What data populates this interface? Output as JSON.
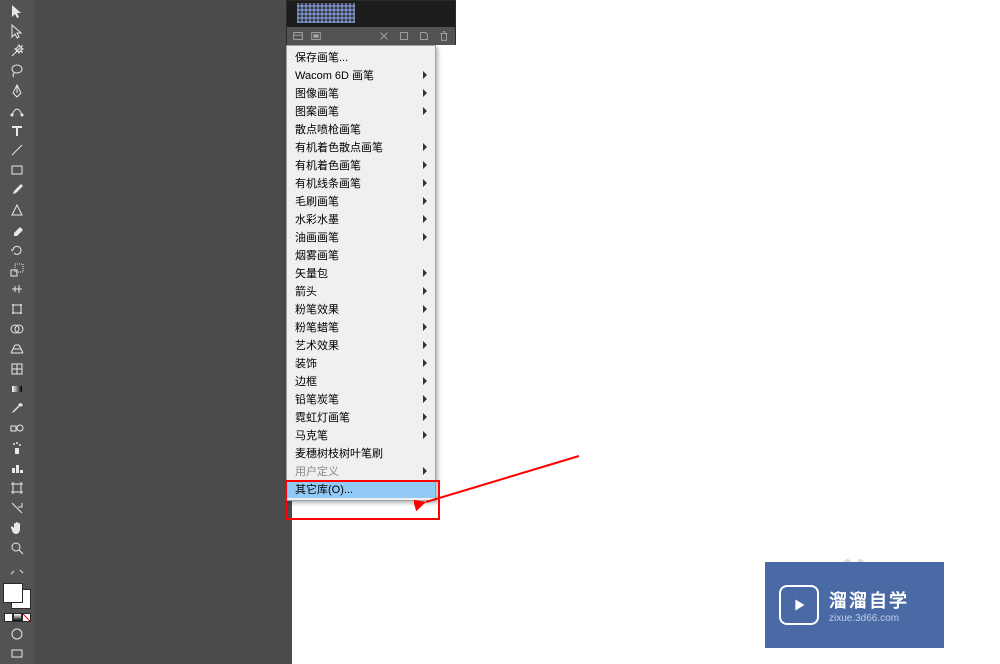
{
  "toolbar": {
    "tools": [
      "selection-tool",
      "direct-selection-tool",
      "magic-wand-tool",
      "lasso-tool",
      "pen-tool",
      "curvature-tool",
      "type-tool",
      "line-segment-tool",
      "rectangle-tool",
      "paintbrush-tool",
      "shaper-tool",
      "eraser-tool",
      "rotate-tool",
      "scale-tool",
      "width-tool",
      "free-transform-tool",
      "shape-builder-tool",
      "perspective-grid-tool",
      "mesh-tool",
      "gradient-tool",
      "eyedropper-tool",
      "blend-tool",
      "symbol-sprayer-tool",
      "column-graph-tool",
      "artboard-tool",
      "slice-tool",
      "hand-tool",
      "zoom-tool"
    ]
  },
  "brush_panel": {
    "footer_icons": [
      "library-icon",
      "brush-options-icon",
      "remove-stroke-icon",
      "new-brush-icon",
      "options-icon",
      "delete-icon"
    ]
  },
  "menu": {
    "items": [
      {
        "label": "保存画笔...",
        "submenu": false
      },
      {
        "label": "Wacom 6D 画笔",
        "submenu": true
      },
      {
        "label": "图像画笔",
        "submenu": true
      },
      {
        "label": "图案画笔",
        "submenu": true
      },
      {
        "label": "散点喷枪画笔",
        "submenu": false
      },
      {
        "label": "有机着色散点画笔",
        "submenu": true
      },
      {
        "label": "有机着色画笔",
        "submenu": true
      },
      {
        "label": "有机线条画笔",
        "submenu": true
      },
      {
        "label": "毛刷画笔",
        "submenu": true
      },
      {
        "label": "水彩水墨",
        "submenu": true
      },
      {
        "label": "油画画笔",
        "submenu": true
      },
      {
        "label": "烟雾画笔",
        "submenu": false
      },
      {
        "label": "矢量包",
        "submenu": true
      },
      {
        "label": "箭头",
        "submenu": true
      },
      {
        "label": "粉笔效果",
        "submenu": true
      },
      {
        "label": "粉笔蜡笔",
        "submenu": true
      },
      {
        "label": "艺术效果",
        "submenu": true
      },
      {
        "label": "装饰",
        "submenu": true
      },
      {
        "label": "边框",
        "submenu": true
      },
      {
        "label": "铅笔炭笔",
        "submenu": true
      },
      {
        "label": "霓虹灯画笔",
        "submenu": true
      },
      {
        "label": "马克笔",
        "submenu": true
      },
      {
        "label": "麦穗树枝树叶笔刷",
        "submenu": false
      },
      {
        "label": "用户定义",
        "submenu": true,
        "disabled": true
      },
      {
        "label": "其它库(O)...",
        "submenu": false,
        "hovered": true
      }
    ]
  },
  "watermark": {
    "title": "溜溜自学",
    "subtitle": "zixue.3d66.com"
  }
}
